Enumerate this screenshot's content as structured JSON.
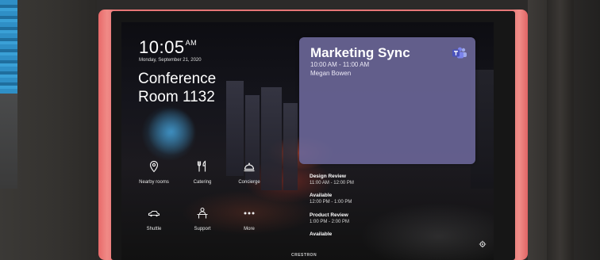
{
  "panel": {
    "time": "10:05",
    "ampm": "AM",
    "date": "Monday, September 21, 2020",
    "room_line1": "Conference",
    "room_line2": "Room 1132"
  },
  "meeting": {
    "title": "Marketing Sync",
    "time_range": "10:00 AM - 11:00 AM",
    "organizer": "Megan Bowen",
    "app_icon": "microsoft-teams-icon"
  },
  "services": [
    {
      "label": "Nearby rooms",
      "icon": "location-pin-icon"
    },
    {
      "label": "Catering",
      "icon": "fork-knife-icon"
    },
    {
      "label": "Concierge",
      "icon": "concierge-bell-icon"
    },
    {
      "label": "Shuttle",
      "icon": "car-icon"
    },
    {
      "label": "Support",
      "icon": "support-desk-icon"
    },
    {
      "label": "More",
      "icon": "more-dots-icon"
    }
  ],
  "schedule": [
    {
      "title": "Design Review",
      "time": "11:00 AM - 12:00 PM"
    },
    {
      "title": "Available",
      "time": "12:00 PM - 1:00 PM"
    },
    {
      "title": "Product Review",
      "time": "1:00 PM - 2:00 PM"
    },
    {
      "title": "Available",
      "time": ""
    }
  ],
  "brand": "CRESTRON",
  "colors": {
    "bezel": "#e87474",
    "meeting_card": "#68649a",
    "text": "#ffffff"
  }
}
